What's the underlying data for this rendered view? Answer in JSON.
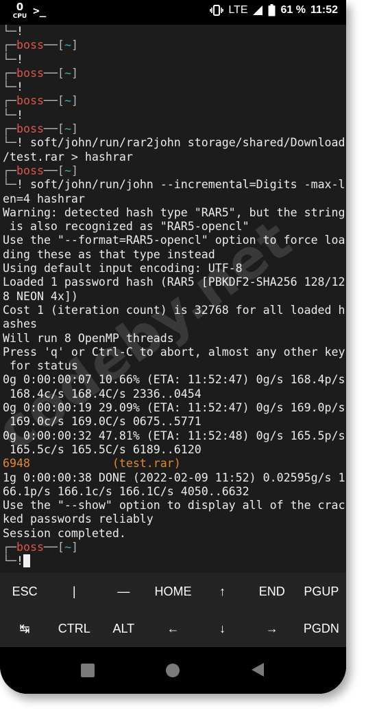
{
  "status_bar": {
    "cpu_digit": "0",
    "cpu_label": "CPU",
    "app_icon": "terminal-prompt-icon",
    "vibrate_icon": "vibrate-icon",
    "network": "LTE",
    "signal_icon": "signal-icon",
    "battery_icon": "battery-icon",
    "battery": "61 %",
    "time": "11:52"
  },
  "terminal": {
    "lines": [
      [
        {
          "t": "└─",
          "c": "c-gray"
        },
        {
          "t": "!",
          "c": "c-white"
        }
      ],
      [
        {
          "t": "┌─",
          "c": "c-gray"
        },
        {
          "t": "boss",
          "c": "c-red"
        },
        {
          "t": "──[",
          "c": "c-gray"
        },
        {
          "t": "~",
          "c": "c-teal"
        },
        {
          "t": "]",
          "c": "c-gray"
        }
      ],
      [
        {
          "t": "└─",
          "c": "c-gray"
        },
        {
          "t": "!",
          "c": "c-white"
        }
      ],
      [
        {
          "t": "┌─",
          "c": "c-gray"
        },
        {
          "t": "boss",
          "c": "c-red"
        },
        {
          "t": "──[",
          "c": "c-gray"
        },
        {
          "t": "~",
          "c": "c-teal"
        },
        {
          "t": "]",
          "c": "c-gray"
        }
      ],
      [
        {
          "t": "└─",
          "c": "c-gray"
        },
        {
          "t": "!",
          "c": "c-white"
        }
      ],
      [
        {
          "t": "┌─",
          "c": "c-gray"
        },
        {
          "t": "boss",
          "c": "c-red"
        },
        {
          "t": "──[",
          "c": "c-gray"
        },
        {
          "t": "~",
          "c": "c-teal"
        },
        {
          "t": "]",
          "c": "c-gray"
        }
      ],
      [
        {
          "t": "└─",
          "c": "c-gray"
        },
        {
          "t": "!",
          "c": "c-white"
        }
      ],
      [
        {
          "t": "┌─",
          "c": "c-gray"
        },
        {
          "t": "boss",
          "c": "c-red"
        },
        {
          "t": "──[",
          "c": "c-gray"
        },
        {
          "t": "~",
          "c": "c-teal"
        },
        {
          "t": "]",
          "c": "c-gray"
        }
      ],
      [
        {
          "t": "└─",
          "c": "c-gray"
        },
        {
          "t": "!",
          "c": "c-white"
        },
        {
          "t": " soft/john/run/rar2john storage/shared/Download",
          "c": "c-white"
        }
      ],
      [
        {
          "t": "/test.rar > hashrar",
          "c": "c-white"
        }
      ],
      [
        {
          "t": "┌─",
          "c": "c-gray"
        },
        {
          "t": "boss",
          "c": "c-red"
        },
        {
          "t": "──[",
          "c": "c-gray"
        },
        {
          "t": "~",
          "c": "c-teal"
        },
        {
          "t": "]",
          "c": "c-gray"
        }
      ],
      [
        {
          "t": "└─",
          "c": "c-gray"
        },
        {
          "t": "!",
          "c": "c-white"
        },
        {
          "t": " soft/john/run/john --incremental=Digits -max-l",
          "c": "c-white"
        }
      ],
      [
        {
          "t": "en=4 hashrar",
          "c": "c-white"
        }
      ],
      [
        {
          "t": "Warning: detected hash type \"RAR5\", but the string",
          "c": "c-white"
        }
      ],
      [
        {
          "t": " is also recognized as \"RAR5-opencl\"",
          "c": "c-white"
        }
      ],
      [
        {
          "t": "Use the \"--format=RAR5-opencl\" option to force loa",
          "c": "c-white"
        }
      ],
      [
        {
          "t": "ding these as that type instead",
          "c": "c-white"
        }
      ],
      [
        {
          "t": "Using default input encoding: UTF-8",
          "c": "c-white"
        }
      ],
      [
        {
          "t": "Loaded 1 password hash (RAR5 [PBKDF2-SHA256 128/12",
          "c": "c-white"
        }
      ],
      [
        {
          "t": "8 NEON 4x])",
          "c": "c-white"
        }
      ],
      [
        {
          "t": "Cost 1 (iteration count) is 32768 for all loaded h",
          "c": "c-white"
        }
      ],
      [
        {
          "t": "ashes",
          "c": "c-white"
        }
      ],
      [
        {
          "t": "Will run 8 OpenMP threads",
          "c": "c-white"
        }
      ],
      [
        {
          "t": "Press 'q' or Ctrl-C to abort, almost any other key",
          "c": "c-white"
        }
      ],
      [
        {
          "t": " for status",
          "c": "c-white"
        }
      ],
      [
        {
          "t": "0g 0:00:00:07 10.66% (ETA: 11:52:47) 0g/s 168.4p/s",
          "c": "c-white"
        }
      ],
      [
        {
          "t": " 168.4c/s 168.4C/s 2336..0454",
          "c": "c-white"
        }
      ],
      [
        {
          "t": "0g 0:00:00:19 29.09% (ETA: 11:52:47) 0g/s 169.0p/s",
          "c": "c-white"
        }
      ],
      [
        {
          "t": " 169.0c/s 169.0C/s 0675..5771",
          "c": "c-white"
        }
      ],
      [
        {
          "t": "0g 0:00:00:32 47.81% (ETA: 11:52:48) 0g/s 165.5p/s",
          "c": "c-white"
        }
      ],
      [
        {
          "t": " 165.5c/s 165.5C/s 6189..6120",
          "c": "c-white"
        }
      ],
      [
        {
          "t": "6948            (test.rar)",
          "c": "c-orange"
        }
      ],
      [
        {
          "t": "1g 0:00:00:38 DONE (2022-02-09 11:52) 0.02595g/s 1",
          "c": "c-white"
        }
      ],
      [
        {
          "t": "66.1p/s 166.1c/s 166.1C/s 4050..6632",
          "c": "c-white"
        }
      ],
      [
        {
          "t": "Use the \"--show\" option to display all of the crac",
          "c": "c-white"
        }
      ],
      [
        {
          "t": "ked passwords reliably",
          "c": "c-white"
        }
      ],
      [
        {
          "t": "Session completed.",
          "c": "c-white"
        }
      ],
      [
        {
          "t": "┌─",
          "c": "c-gray"
        },
        {
          "t": "boss",
          "c": "c-red"
        },
        {
          "t": "──[",
          "c": "c-gray"
        },
        {
          "t": "~",
          "c": "c-teal"
        },
        {
          "t": "]",
          "c": "c-gray"
        }
      ],
      [
        {
          "t": "└─",
          "c": "c-gray"
        },
        {
          "t": "!",
          "c": "c-white"
        },
        {
          "cursor": true
        }
      ]
    ]
  },
  "extra_keys": [
    {
      "label": "ESC",
      "name": "esc-key"
    },
    {
      "label": "|",
      "name": "pipe-key"
    },
    {
      "label": "—",
      "name": "dash-key"
    },
    {
      "label": "HOME",
      "name": "home-key"
    },
    {
      "label": "↑",
      "name": "up-arrow-key"
    },
    {
      "label": "END",
      "name": "end-key"
    },
    {
      "label": "PGUP",
      "name": "pgup-key"
    },
    {
      "label": "↹",
      "name": "tab-key"
    },
    {
      "label": "CTRL",
      "name": "ctrl-key"
    },
    {
      "label": "ALT",
      "name": "alt-key"
    },
    {
      "label": "←",
      "name": "left-arrow-key"
    },
    {
      "label": "↓",
      "name": "down-arrow-key"
    },
    {
      "label": "→",
      "name": "right-arrow-key"
    },
    {
      "label": "PGDN",
      "name": "pgdn-key"
    }
  ],
  "nav_bar": {
    "recents_icon": "recents-square-icon",
    "home_icon": "home-circle-icon",
    "back_icon": "back-triangle-icon"
  },
  "watermark": "codeby.net"
}
